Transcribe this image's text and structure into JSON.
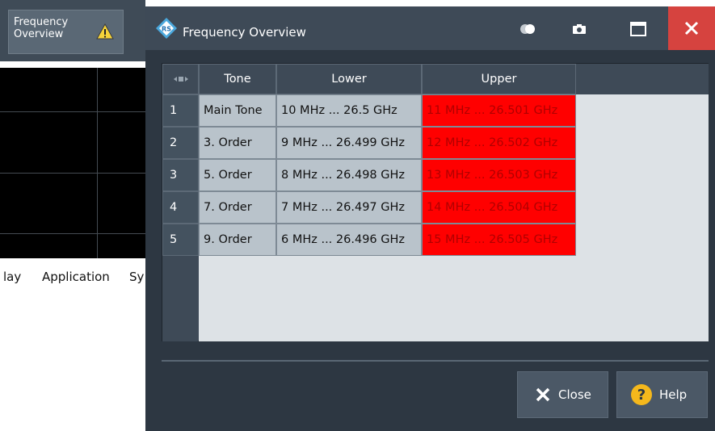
{
  "background_app": {
    "freq_button_label_line1": "Frequency",
    "freq_button_label_line2": "Overview",
    "menu_items": [
      "lay",
      "Application",
      "Sy"
    ]
  },
  "dialog": {
    "title": "Frequency Overview",
    "accent_colors": {
      "close_bg": "#d6433f",
      "upper_cell_bg": "#ff0000"
    },
    "table": {
      "columns": [
        "Tone",
        "Lower",
        "Upper"
      ],
      "rows": [
        {
          "num": "1",
          "tone": "Main Tone",
          "lower": "10 MHz ... 26.5 GHz",
          "upper": "11 MHz ... 26.501 GHz"
        },
        {
          "num": "2",
          "tone": "3. Order",
          "lower": "9 MHz ... 26.499 GHz",
          "upper": "12 MHz ... 26.502 GHz"
        },
        {
          "num": "3",
          "tone": "5. Order",
          "lower": "8 MHz ... 26.498 GHz",
          "upper": "13 MHz ... 26.503 GHz"
        },
        {
          "num": "4",
          "tone": "7. Order",
          "lower": "7 MHz ... 26.497 GHz",
          "upper": "14 MHz ... 26.504 GHz"
        },
        {
          "num": "5",
          "tone": "9. Order",
          "lower": "6 MHz ... 26.496 GHz",
          "upper": "15 MHz ... 26.505 GHz"
        }
      ]
    },
    "buttons": {
      "close_label": "Close",
      "help_label": "Help"
    }
  }
}
